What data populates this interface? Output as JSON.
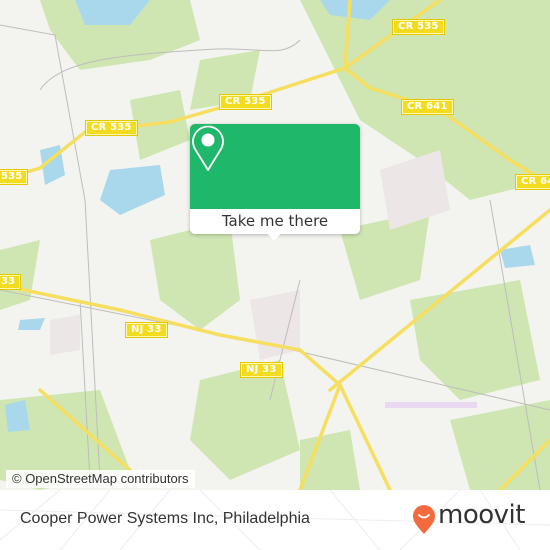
{
  "map": {
    "road_labels": [
      {
        "text": "CR 535",
        "id": "cr535-top"
      },
      {
        "text": "CR 535",
        "id": "cr535-mid-right"
      },
      {
        "text": "CR 535",
        "id": "cr535-mid-left"
      },
      {
        "text": "535",
        "id": "cr535-left-edge"
      },
      {
        "text": "CR 641",
        "id": "cr641"
      },
      {
        "text": "CR 64",
        "id": "cr641-right-edge"
      },
      {
        "text": "33",
        "id": "nj33-left-edge"
      },
      {
        "text": "NJ 33",
        "id": "nj33-mid"
      },
      {
        "text": "NJ 33",
        "id": "nj33-right"
      }
    ],
    "attribution": "© OpenStreetMap contributors",
    "colors": {
      "background": "#f3f4ef",
      "forest": "#cfe6b2",
      "water": "#a9d8ec",
      "road": "#f5de60",
      "label": "#f3dc1f"
    }
  },
  "popup": {
    "button_label": "Take me there",
    "icon": "map-pin-icon",
    "accent_color": "#1fb86b"
  },
  "footer": {
    "place_name": "Cooper Power Systems Inc, Philadelphia",
    "brand": "moovit",
    "brand_color": "#f26a3d"
  }
}
